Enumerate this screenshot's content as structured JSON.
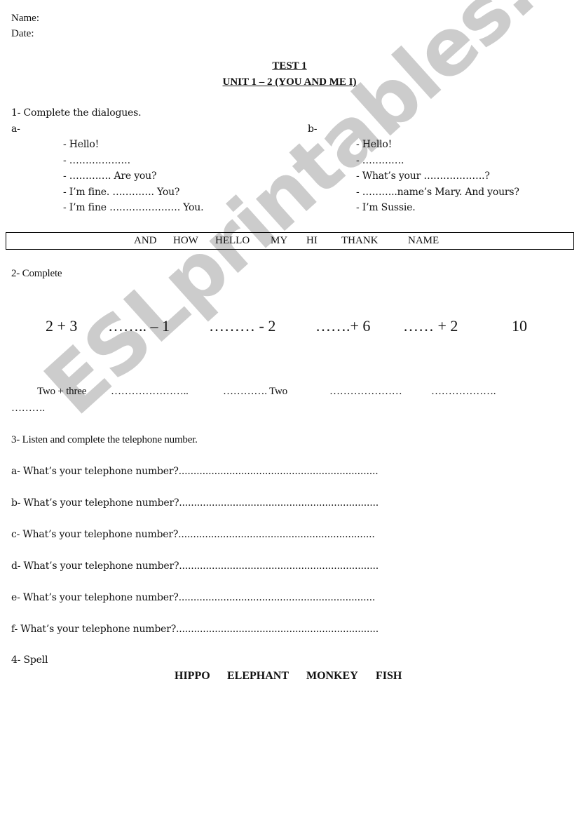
{
  "header": {
    "name_label": "Name:",
    "date_label": "Date:"
  },
  "title": {
    "line1": "TEST 1",
    "line2": "UNIT 1 – 2 (YOU AND ME I)"
  },
  "section1": {
    "heading": "1- Complete the dialogues.",
    "dialogue_a": {
      "label": "a-",
      "lines": [
        "- Hello!",
        "- ……………….",
        "- …………. Are you?",
        "- I’m fine. …………. You?",
        "- I’m fine …………………. You."
      ]
    },
    "dialogue_b": {
      "label": "b-",
      "lines": [
        "- Hello!",
        "- ………….",
        "- What’s your ……………….?",
        "- ………..name’s Mary. And yours?",
        "- I’m Sussie."
      ]
    },
    "word_bank": [
      "AND",
      "HOW",
      "HELLO",
      "MY",
      "HI",
      "THANK",
      "NAME"
    ]
  },
  "section2": {
    "heading": "2- Complete",
    "math_sequence": [
      "2 + 3",
      "…….. – 1",
      "……… - 2",
      "…….+ 6",
      "…… + 2",
      "10"
    ],
    "word_sequence": [
      "Two + three",
      "…………………..",
      "…………. Two",
      "…………………",
      "……………….",
      "………."
    ]
  },
  "section3": {
    "heading": "3- Listen and complete the telephone number.",
    "questions": [
      "a- What’s your telephone number?...................................................................",
      "b- What’s your telephone number?...................................................................",
      "c- What’s your telephone number?..................................................................",
      "d- What’s your telephone number?...................................................................",
      "e- What’s your telephone number?..................................................................",
      "f- What’s your telephone number?...................................................................."
    ]
  },
  "section4": {
    "heading": "4- Spell",
    "words": [
      "HIPPO",
      "ELEPHANT",
      "MONKEY",
      "FISH"
    ]
  },
  "watermark": "ESLprintables.com"
}
